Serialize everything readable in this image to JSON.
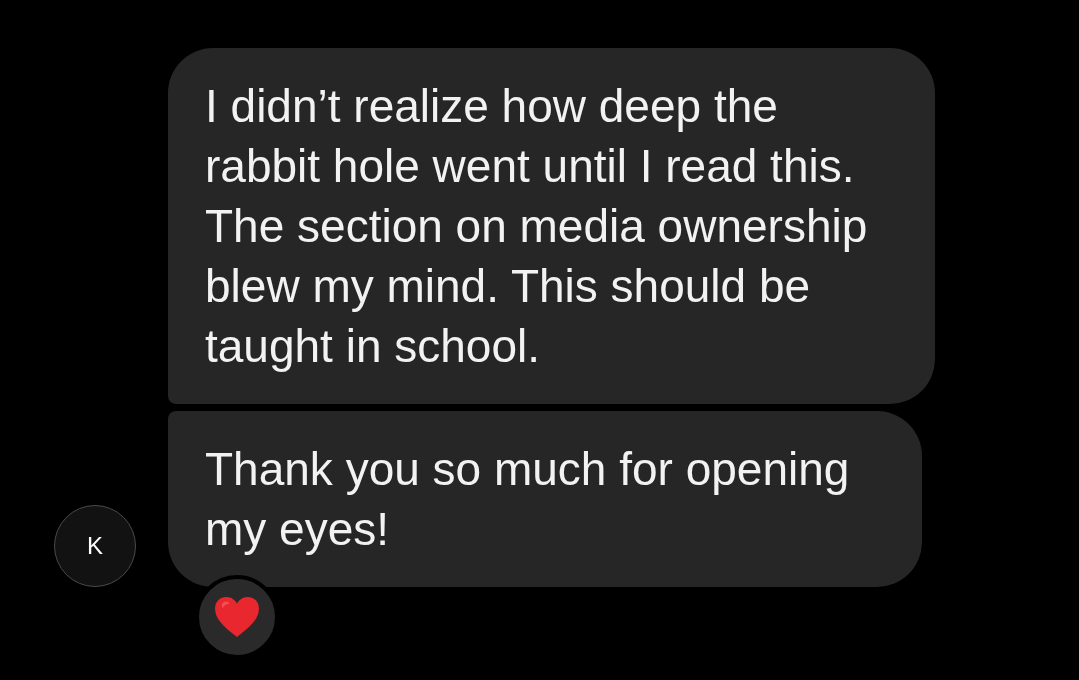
{
  "avatar": {
    "initial": "K"
  },
  "messages": [
    {
      "text": "I didn’t realize how deep the rabbit hole went until I read this. The section on media ownership blew my mind. This should be taught in school."
    },
    {
      "text": "Thank you so much for opening my eyes!"
    }
  ],
  "reaction": {
    "kind": "heart"
  }
}
